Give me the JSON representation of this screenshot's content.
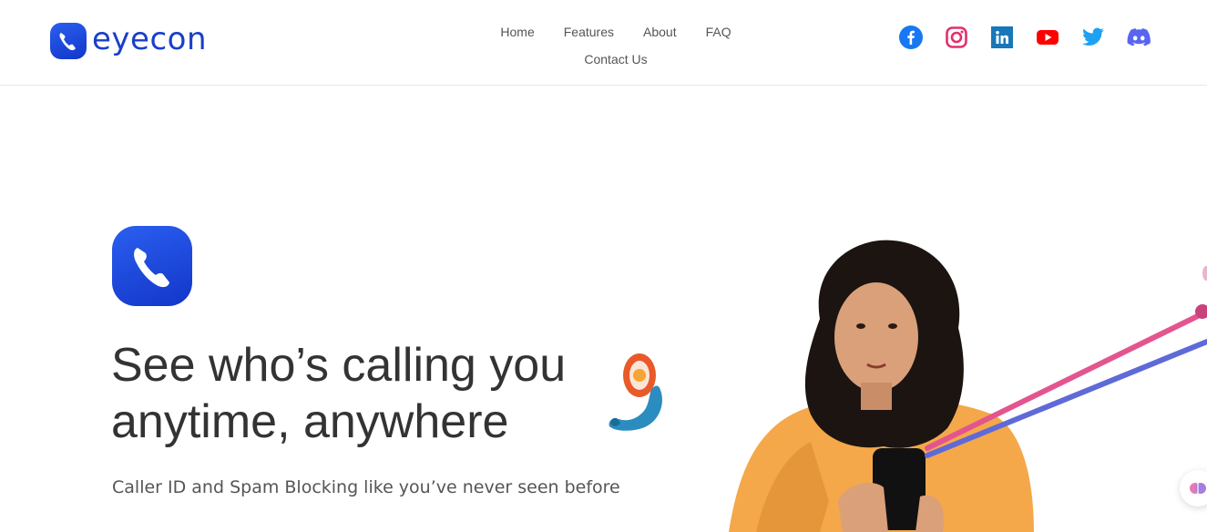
{
  "brand": {
    "name": "eyecon"
  },
  "nav": {
    "items": [
      {
        "label": "Home"
      },
      {
        "label": "Features"
      },
      {
        "label": "About"
      },
      {
        "label": "FAQ"
      },
      {
        "label": "Contact Us"
      }
    ]
  },
  "social": [
    {
      "icon": "facebook-icon",
      "color": "#1877f2"
    },
    {
      "icon": "instagram-icon",
      "color": "#e1306c"
    },
    {
      "icon": "linkedin-icon",
      "color": "#0a66c2"
    },
    {
      "icon": "youtube-icon",
      "color": "#ff0000"
    },
    {
      "icon": "twitter-icon",
      "color": "#1da1f2"
    },
    {
      "icon": "discord-icon",
      "color": "#5865f2"
    }
  ],
  "hero": {
    "title": "See who’s calling you anytime, anywhere",
    "subtitle": "Caller ID and Spam Blocking like you’ve never seen before"
  },
  "colors": {
    "brand_blue": "#1a3fc7",
    "text_dark": "#333333",
    "text_muted": "#555555"
  }
}
